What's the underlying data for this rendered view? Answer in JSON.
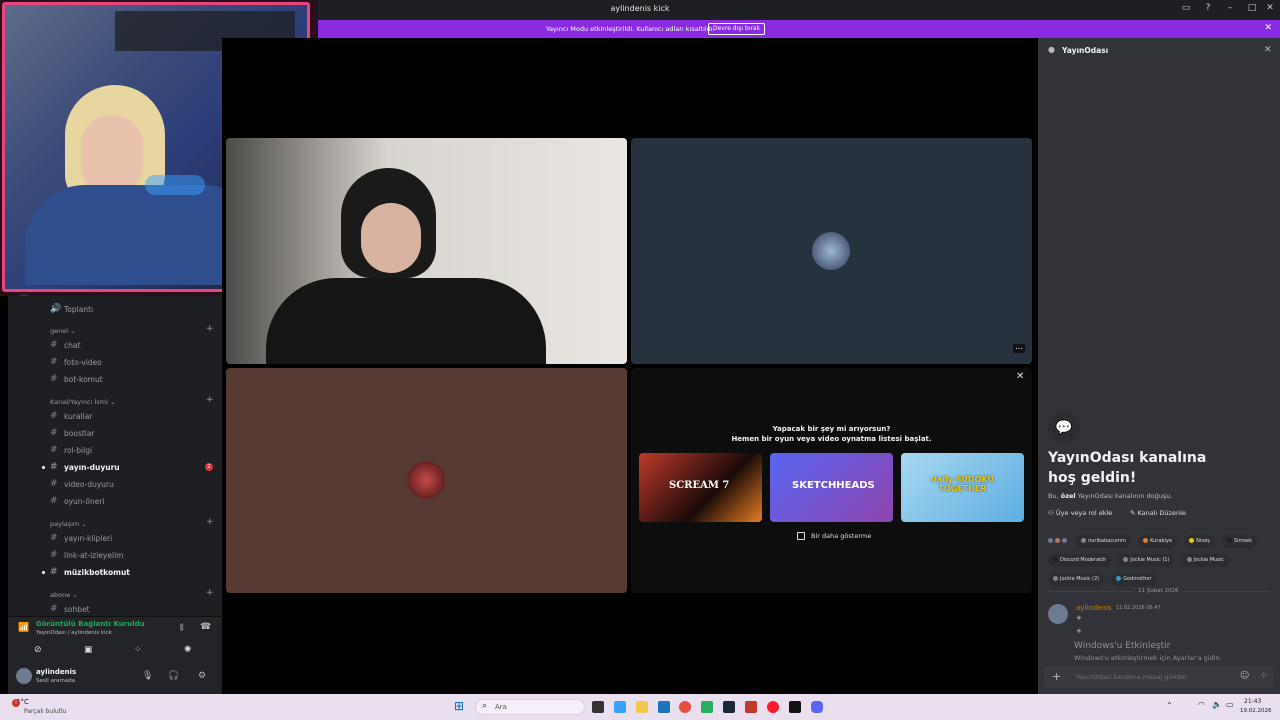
{
  "window": {
    "title": "aylindenis kick"
  },
  "banner": {
    "text": "Yayıncı Modu etkinleştirildi. Kullanıcı adları kısaltıldı.",
    "button": "Devre dışı bırak"
  },
  "sidebar": {
    "top_item": "Toplantı",
    "categories": [
      {
        "name": "genel",
        "channels": [
          "chat",
          "foto-video",
          "bot-komut"
        ]
      },
      {
        "name": "Kanal/Yayıncı İsmi",
        "channels": [
          "kurallar",
          "boostlar",
          "rol-bilgi",
          "yayın-duyuru",
          "video-duyuru",
          "oyun-öneri"
        ]
      },
      {
        "name": "paylaşım",
        "channels": [
          "yayın-klipleri",
          "link-at-izleyelim",
          "müzikbotkomut"
        ]
      },
      {
        "name": "abone",
        "channels": [
          "sohbet"
        ]
      }
    ],
    "unread_badge": "2"
  },
  "voice": {
    "status": "Görüntülü Bağlantı Kuruldu",
    "location": "YayınOdası / aylindenis kick"
  },
  "user": {
    "name": "aylindenis",
    "status": "Sesli aramada"
  },
  "activity": {
    "line1": "Yapacak bir şey mi arıyorsun?",
    "line2": "Hemen bir oyun veya video oynatma listesi başlat.",
    "games": [
      "SCREAM 7",
      "SKETCHHEADS",
      "daily SUDOKU TOGETHER"
    ],
    "checkbox": "Bir daha gösterme"
  },
  "chat": {
    "header": "YayınOdası",
    "welcome_title": "YayınOdası kanalına hoş geldin!",
    "welcome_sub_pre": "Bu,",
    "welcome_sub_bold": "özel",
    "welcome_sub_post": "YayınOdası kanalının doğuşu.",
    "add_member": "Üye veya rol ekle",
    "edit_channel": "Kanalı Düzenle",
    "roles": [
      {
        "name": "nuribabacumm",
        "color": "#80848e"
      },
      {
        "name": "Kurabiye",
        "color": "#e67e22"
      },
      {
        "name": "Niveş",
        "color": "#f1c40f"
      },
      {
        "name": "Simsek",
        "color": "#1e1f22"
      },
      {
        "name": "Discord Moderatör",
        "color": "#1e1f22"
      },
      {
        "name": "Jockie Music (1)",
        "color": "#80848e"
      },
      {
        "name": "Jockie Music",
        "color": "#80848e"
      },
      {
        "name": "Jockie Music (2)",
        "color": "#80848e"
      },
      {
        "name": "Godmother",
        "color": "#3498db"
      }
    ],
    "date_divider": "11 Şubat 2026",
    "message_author": "aylindenis",
    "message_time": "11.02.2026 06:47",
    "message_lines": [
      "+",
      "+"
    ],
    "watermark1": "Windows'u Etkinleştir",
    "watermark2": "Windows'u etkinleştirmek için Ayarlar'a gidin.",
    "input_placeholder": "YayınOdası kanalına mesaj gönder"
  },
  "taskbar": {
    "weather_temp": "5°C",
    "weather_desc": "Parçalı bulutlu",
    "search": "Ara",
    "time": "21:43",
    "date": "19.02.2026"
  },
  "colors": {
    "accent": "#8a2be2",
    "sidebar": "#1e1f22",
    "chat": "#313338",
    "voice_green": "#23a55a"
  }
}
